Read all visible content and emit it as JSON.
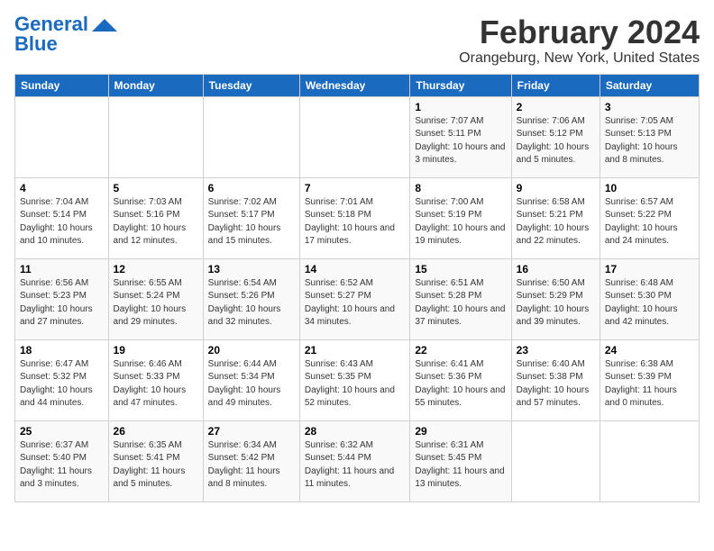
{
  "logo": {
    "part1": "General",
    "part2": "Blue",
    "tagline": ""
  },
  "title": "February 2024",
  "subtitle": "Orangeburg, New York, United States",
  "headers": [
    "Sunday",
    "Monday",
    "Tuesday",
    "Wednesday",
    "Thursday",
    "Friday",
    "Saturday"
  ],
  "weeks": [
    [
      {
        "day": "",
        "info": ""
      },
      {
        "day": "",
        "info": ""
      },
      {
        "day": "",
        "info": ""
      },
      {
        "day": "",
        "info": ""
      },
      {
        "day": "1",
        "info": "Sunrise: 7:07 AM\nSunset: 5:11 PM\nDaylight: 10 hours\nand 3 minutes."
      },
      {
        "day": "2",
        "info": "Sunrise: 7:06 AM\nSunset: 5:12 PM\nDaylight: 10 hours\nand 5 minutes."
      },
      {
        "day": "3",
        "info": "Sunrise: 7:05 AM\nSunset: 5:13 PM\nDaylight: 10 hours\nand 8 minutes."
      }
    ],
    [
      {
        "day": "4",
        "info": "Sunrise: 7:04 AM\nSunset: 5:14 PM\nDaylight: 10 hours\nand 10 minutes."
      },
      {
        "day": "5",
        "info": "Sunrise: 7:03 AM\nSunset: 5:16 PM\nDaylight: 10 hours\nand 12 minutes."
      },
      {
        "day": "6",
        "info": "Sunrise: 7:02 AM\nSunset: 5:17 PM\nDaylight: 10 hours\nand 15 minutes."
      },
      {
        "day": "7",
        "info": "Sunrise: 7:01 AM\nSunset: 5:18 PM\nDaylight: 10 hours\nand 17 minutes."
      },
      {
        "day": "8",
        "info": "Sunrise: 7:00 AM\nSunset: 5:19 PM\nDaylight: 10 hours\nand 19 minutes."
      },
      {
        "day": "9",
        "info": "Sunrise: 6:58 AM\nSunset: 5:21 PM\nDaylight: 10 hours\nand 22 minutes."
      },
      {
        "day": "10",
        "info": "Sunrise: 6:57 AM\nSunset: 5:22 PM\nDaylight: 10 hours\nand 24 minutes."
      }
    ],
    [
      {
        "day": "11",
        "info": "Sunrise: 6:56 AM\nSunset: 5:23 PM\nDaylight: 10 hours\nand 27 minutes."
      },
      {
        "day": "12",
        "info": "Sunrise: 6:55 AM\nSunset: 5:24 PM\nDaylight: 10 hours\nand 29 minutes."
      },
      {
        "day": "13",
        "info": "Sunrise: 6:54 AM\nSunset: 5:26 PM\nDaylight: 10 hours\nand 32 minutes."
      },
      {
        "day": "14",
        "info": "Sunrise: 6:52 AM\nSunset: 5:27 PM\nDaylight: 10 hours\nand 34 minutes."
      },
      {
        "day": "15",
        "info": "Sunrise: 6:51 AM\nSunset: 5:28 PM\nDaylight: 10 hours\nand 37 minutes."
      },
      {
        "day": "16",
        "info": "Sunrise: 6:50 AM\nSunset: 5:29 PM\nDaylight: 10 hours\nand 39 minutes."
      },
      {
        "day": "17",
        "info": "Sunrise: 6:48 AM\nSunset: 5:30 PM\nDaylight: 10 hours\nand 42 minutes."
      }
    ],
    [
      {
        "day": "18",
        "info": "Sunrise: 6:47 AM\nSunset: 5:32 PM\nDaylight: 10 hours\nand 44 minutes."
      },
      {
        "day": "19",
        "info": "Sunrise: 6:46 AM\nSunset: 5:33 PM\nDaylight: 10 hours\nand 47 minutes."
      },
      {
        "day": "20",
        "info": "Sunrise: 6:44 AM\nSunset: 5:34 PM\nDaylight: 10 hours\nand 49 minutes."
      },
      {
        "day": "21",
        "info": "Sunrise: 6:43 AM\nSunset: 5:35 PM\nDaylight: 10 hours\nand 52 minutes."
      },
      {
        "day": "22",
        "info": "Sunrise: 6:41 AM\nSunset: 5:36 PM\nDaylight: 10 hours\nand 55 minutes."
      },
      {
        "day": "23",
        "info": "Sunrise: 6:40 AM\nSunset: 5:38 PM\nDaylight: 10 hours\nand 57 minutes."
      },
      {
        "day": "24",
        "info": "Sunrise: 6:38 AM\nSunset: 5:39 PM\nDaylight: 11 hours\nand 0 minutes."
      }
    ],
    [
      {
        "day": "25",
        "info": "Sunrise: 6:37 AM\nSunset: 5:40 PM\nDaylight: 11 hours\nand 3 minutes."
      },
      {
        "day": "26",
        "info": "Sunrise: 6:35 AM\nSunset: 5:41 PM\nDaylight: 11 hours\nand 5 minutes."
      },
      {
        "day": "27",
        "info": "Sunrise: 6:34 AM\nSunset: 5:42 PM\nDaylight: 11 hours\nand 8 minutes."
      },
      {
        "day": "28",
        "info": "Sunrise: 6:32 AM\nSunset: 5:44 PM\nDaylight: 11 hours\nand 11 minutes."
      },
      {
        "day": "29",
        "info": "Sunrise: 6:31 AM\nSunset: 5:45 PM\nDaylight: 11 hours\nand 13 minutes."
      },
      {
        "day": "",
        "info": ""
      },
      {
        "day": "",
        "info": ""
      }
    ]
  ]
}
